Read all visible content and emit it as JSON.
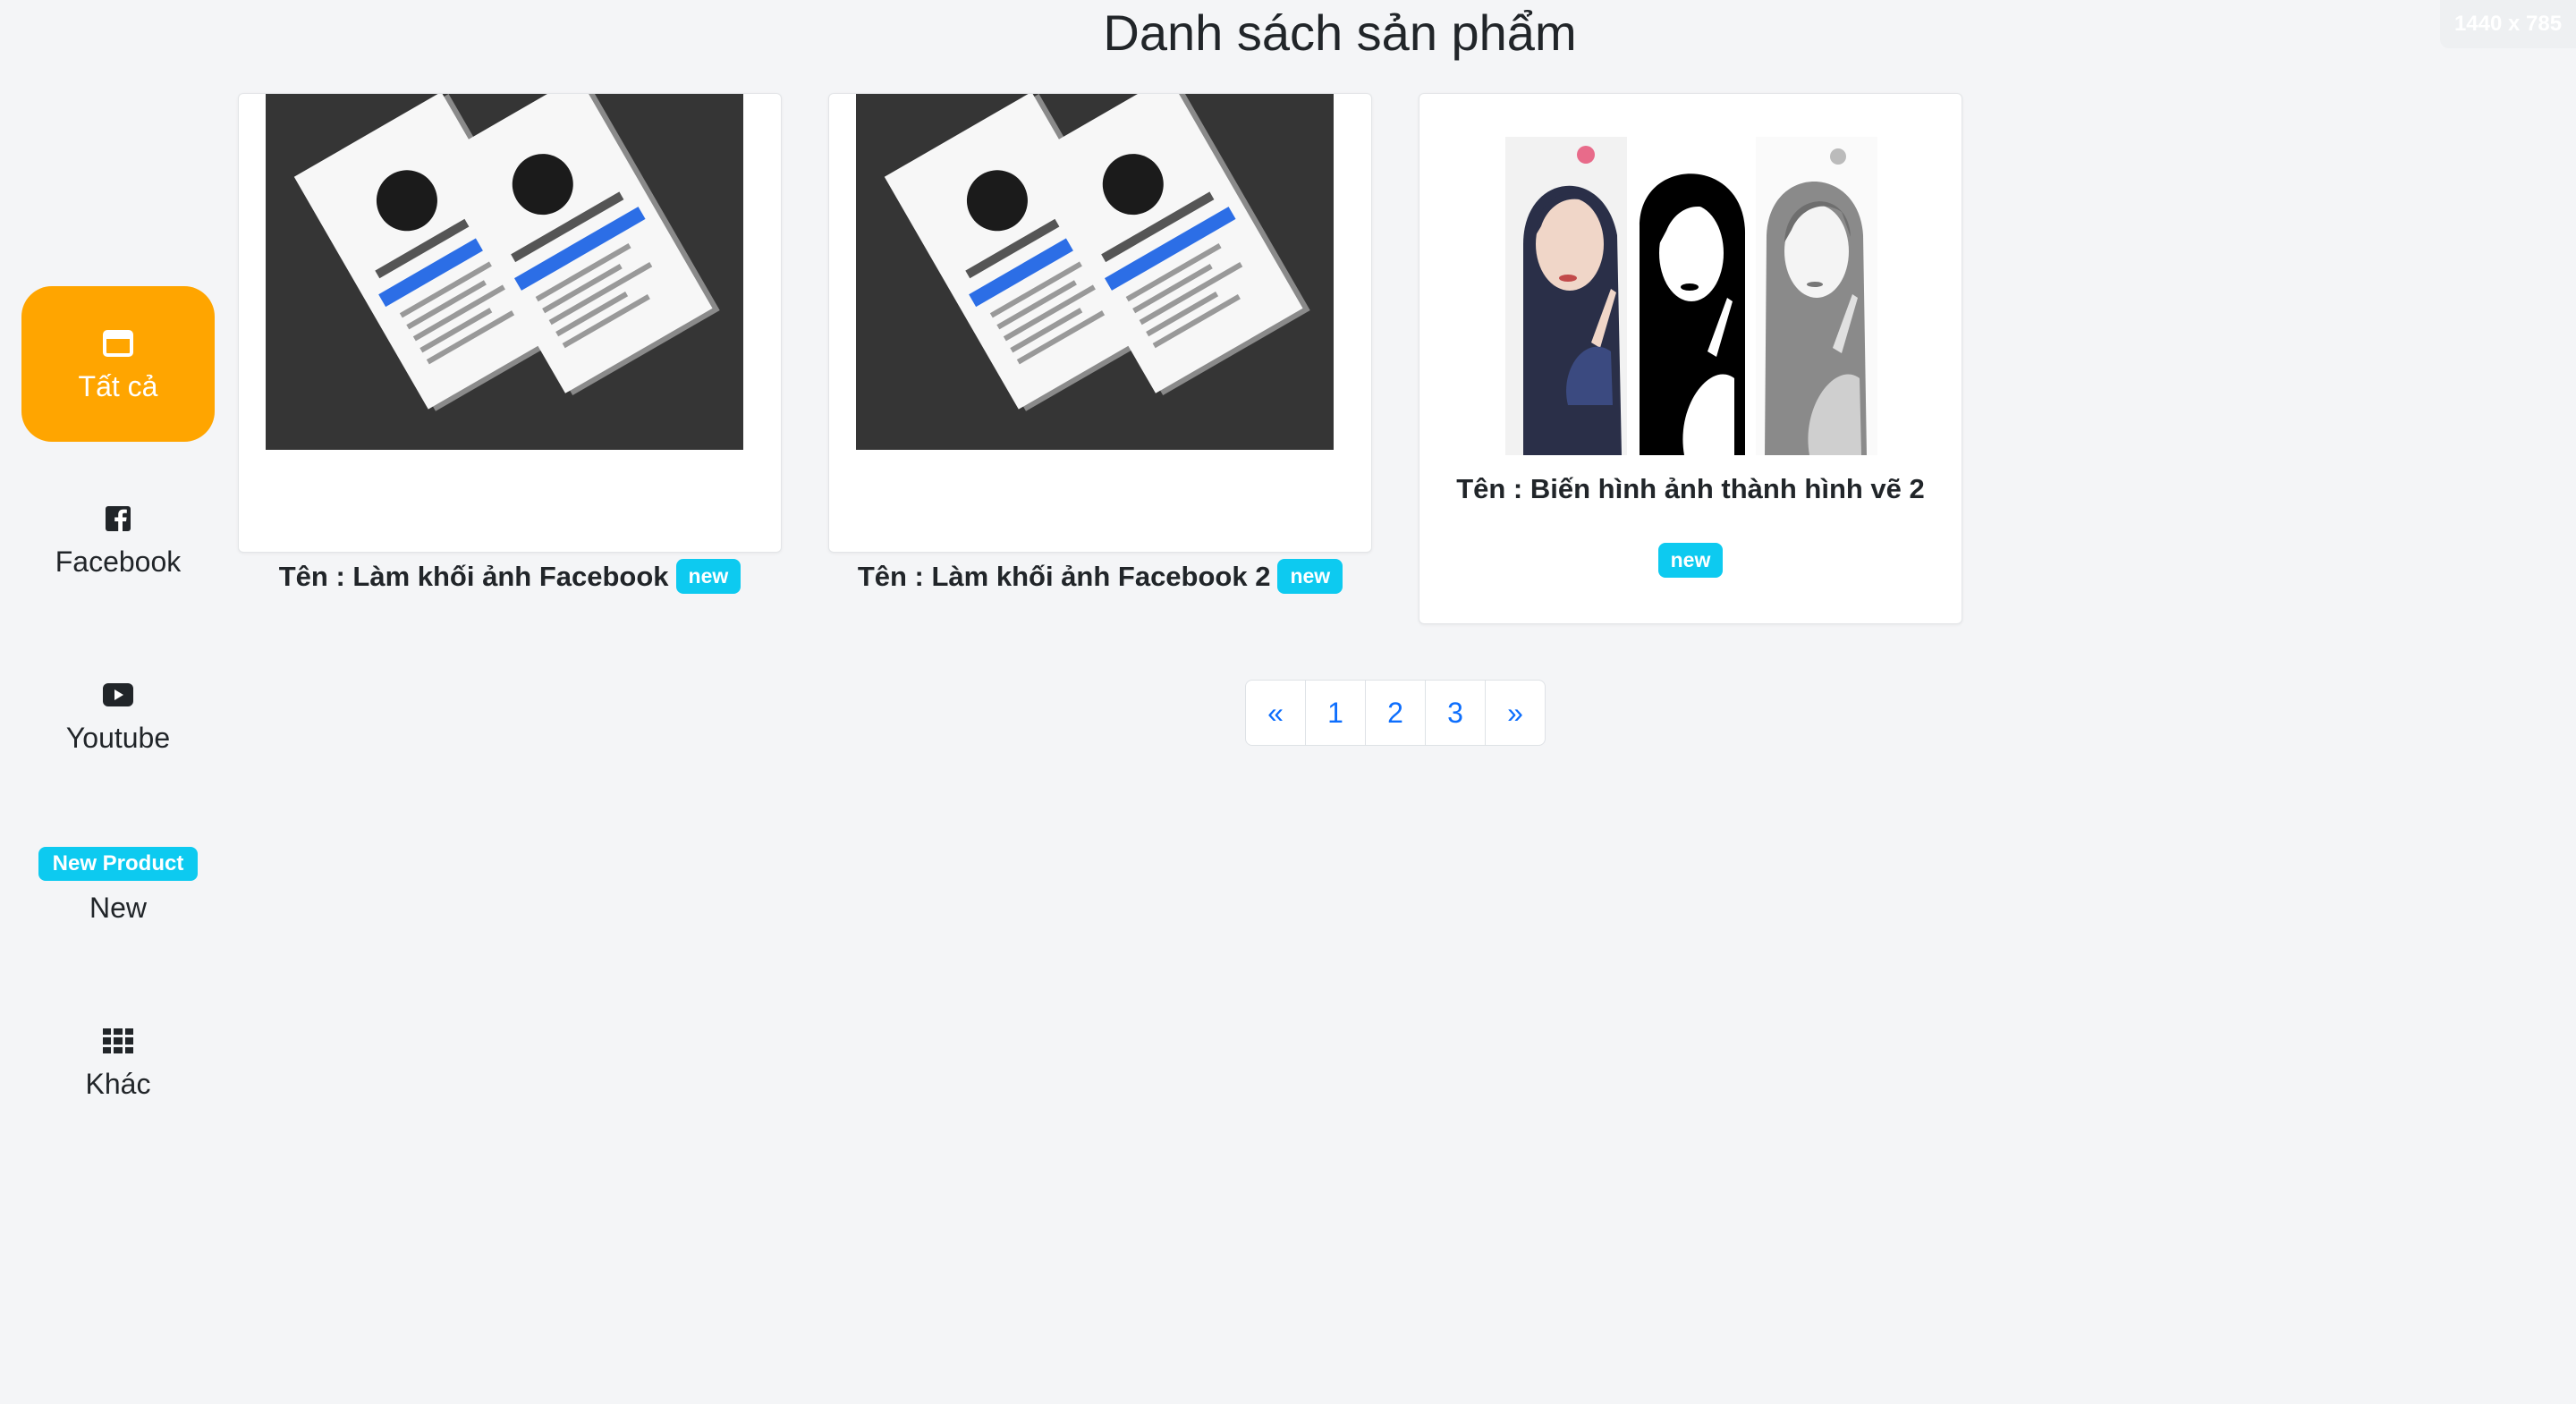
{
  "screen_size_label": "1440 x 785",
  "page_title": "Danh sách sản phẩm",
  "sidebar": {
    "items": [
      {
        "label": "Tất cả",
        "icon": "window-icon",
        "active": true
      },
      {
        "label": "Facebook",
        "icon": "facebook-icon"
      },
      {
        "label": "Youtube",
        "icon": "youtube-icon"
      },
      {
        "label": "New",
        "icon": "new-product-badge",
        "badge": "New Product"
      },
      {
        "label": "Khác",
        "icon": "grid-icon"
      }
    ]
  },
  "products": [
    {
      "title": "Tên : Làm khối ảnh Facebook",
      "badge": "new",
      "image": "facebook-3d-profile-mockup"
    },
    {
      "title": "Tên : Làm khối ảnh Facebook 2",
      "badge": "new",
      "image": "facebook-3d-profile-mockup"
    },
    {
      "title": "Tên : Biến hình ảnh thành hình vẽ 2",
      "badge": "new",
      "image": "photo-to-sketch-triptych"
    }
  ],
  "pagination": {
    "prev": "«",
    "pages": [
      "1",
      "2",
      "3"
    ],
    "next": "»"
  },
  "colors": {
    "accent": "#ffa500",
    "badge": "#0dcaf0",
    "link": "#0d6efd",
    "background": "#f4f5f7"
  }
}
